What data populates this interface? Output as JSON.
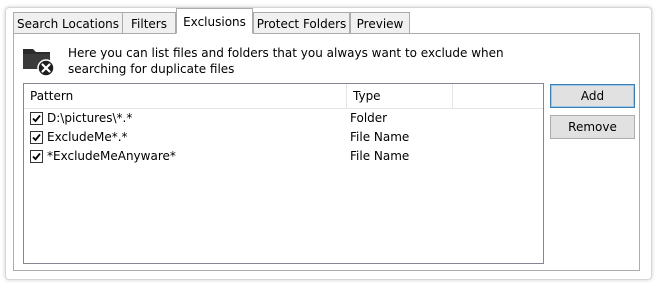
{
  "tabs": [
    {
      "label": "Search Locations"
    },
    {
      "label": "Filters"
    },
    {
      "label": "Exclusions"
    },
    {
      "label": "Protect Folders"
    },
    {
      "label": "Preview"
    }
  ],
  "active_tab": "Exclusions",
  "description": "Here you can list files and folders that you always want to exclude when searching for duplicate files",
  "list": {
    "columns": [
      {
        "label": "Pattern"
      },
      {
        "label": "Type"
      }
    ],
    "rows": [
      {
        "pattern": "D:\\pictures\\*.*",
        "type": "Folder",
        "checked": true
      },
      {
        "pattern": "ExcludeMe*.*",
        "type": "File Name",
        "checked": true
      },
      {
        "pattern": "*ExcludeMeAnyware*",
        "type": "File Name",
        "checked": true
      }
    ]
  },
  "buttons": {
    "add": "Add",
    "remove": "Remove"
  },
  "icons": {
    "header_icon": "folder-remove-icon",
    "checkbox_mark": "checkmark-icon"
  }
}
